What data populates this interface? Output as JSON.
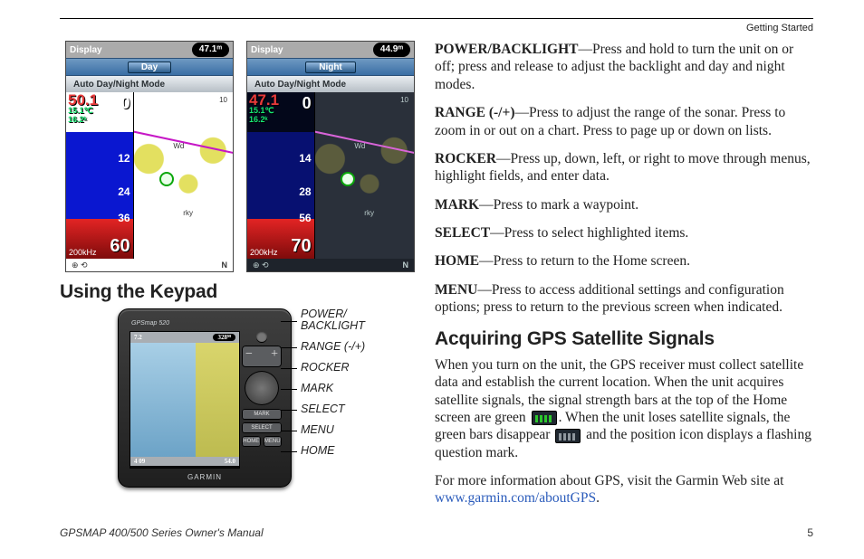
{
  "header": {
    "section": "Getting Started"
  },
  "screenshots": {
    "left": {
      "title_label": "Display",
      "badge": "47.1ᵐ",
      "mode_pill": "Day",
      "auto_label": "Auto Day/Night Mode",
      "sonar": {
        "depth_top": "50.1",
        "sub1": "15.1℃",
        "sub2": "16.2ᵏ",
        "zero": "0",
        "t1": "12",
        "t2": "24",
        "t3": "36",
        "depth_big": "60",
        "freq": "200kHz"
      }
    },
    "right": {
      "title_label": "Display",
      "badge": "44.9ᵐ",
      "mode_pill": "Night",
      "auto_label": "Auto Day/Night Mode",
      "sonar": {
        "depth_top": "47.1",
        "sub1": "15.1℃",
        "sub2": "16.2ᵏ",
        "zero": "0",
        "t1": "14",
        "t2": "28",
        "t3": "56",
        "depth_big": "70",
        "freq": "200kHz"
      }
    },
    "north": "N"
  },
  "headings": {
    "keypad": "Using the Keypad",
    "gps": "Acquiring GPS Satellite Signals"
  },
  "device": {
    "model": "GPSmap 520",
    "brand": "GARMIN",
    "shdr_l": "7.2",
    "shdr_r": "328ᴹ",
    "sftr_l": "4 09",
    "sftr_r": "54.0",
    "btn_mark": "MARK",
    "btn_select": "SELECT",
    "btn_home": "HOME",
    "btn_menu": "MENU"
  },
  "labels": {
    "power1": "POWER/",
    "power2": "BACKLIGHT",
    "range": "RANGE (-/+)",
    "rocker": "ROCKER",
    "mark": "MARK",
    "select": "SELECT",
    "menu": "MENU",
    "home": "HOME"
  },
  "desc": {
    "powerA": "POWER/BACKLIGHT",
    "powerB": "—Press and hold to turn the unit on or off; press and release to adjust the backlight and day and night modes.",
    "rangeA": "RANGE (-/+)",
    "rangeB": "—Press to adjust the range of the sonar. Press to zoom in or out on a chart. Press to page up or down on lists.",
    "rockerA": "ROCKER",
    "rockerB": "—Press up, down, left, or right to move through menus, highlight fields, and enter data.",
    "markA": "MARK",
    "markB": "—Press to mark a waypoint.",
    "selectA": "SELECT",
    "selectB": "—Press to select highlighted items.",
    "homeA": "HOME",
    "homeB": "—Press to return to the Home screen.",
    "menuA": "MENU",
    "menuB": "—Press to access additional settings and configuration options; press to return to the previous screen when indicated."
  },
  "gps": {
    "p1a": "When you turn on the unit, the GPS receiver must collect satellite data and establish the current location. When the unit acquires satellite signals, the signal strength bars at the top of the Home screen are green ",
    "p1b": ". When the unit loses satellite signals, the green bars disappear ",
    "p1c": " and the position icon displays a flashing question mark.",
    "p2a": "For more information about GPS, visit the Garmin Web site at ",
    "link": "www.garmin.com/aboutGPS",
    "p2b": "."
  },
  "footer": {
    "title": "GPSMAP 400/500 Series Owner's Manual",
    "page": "5"
  }
}
